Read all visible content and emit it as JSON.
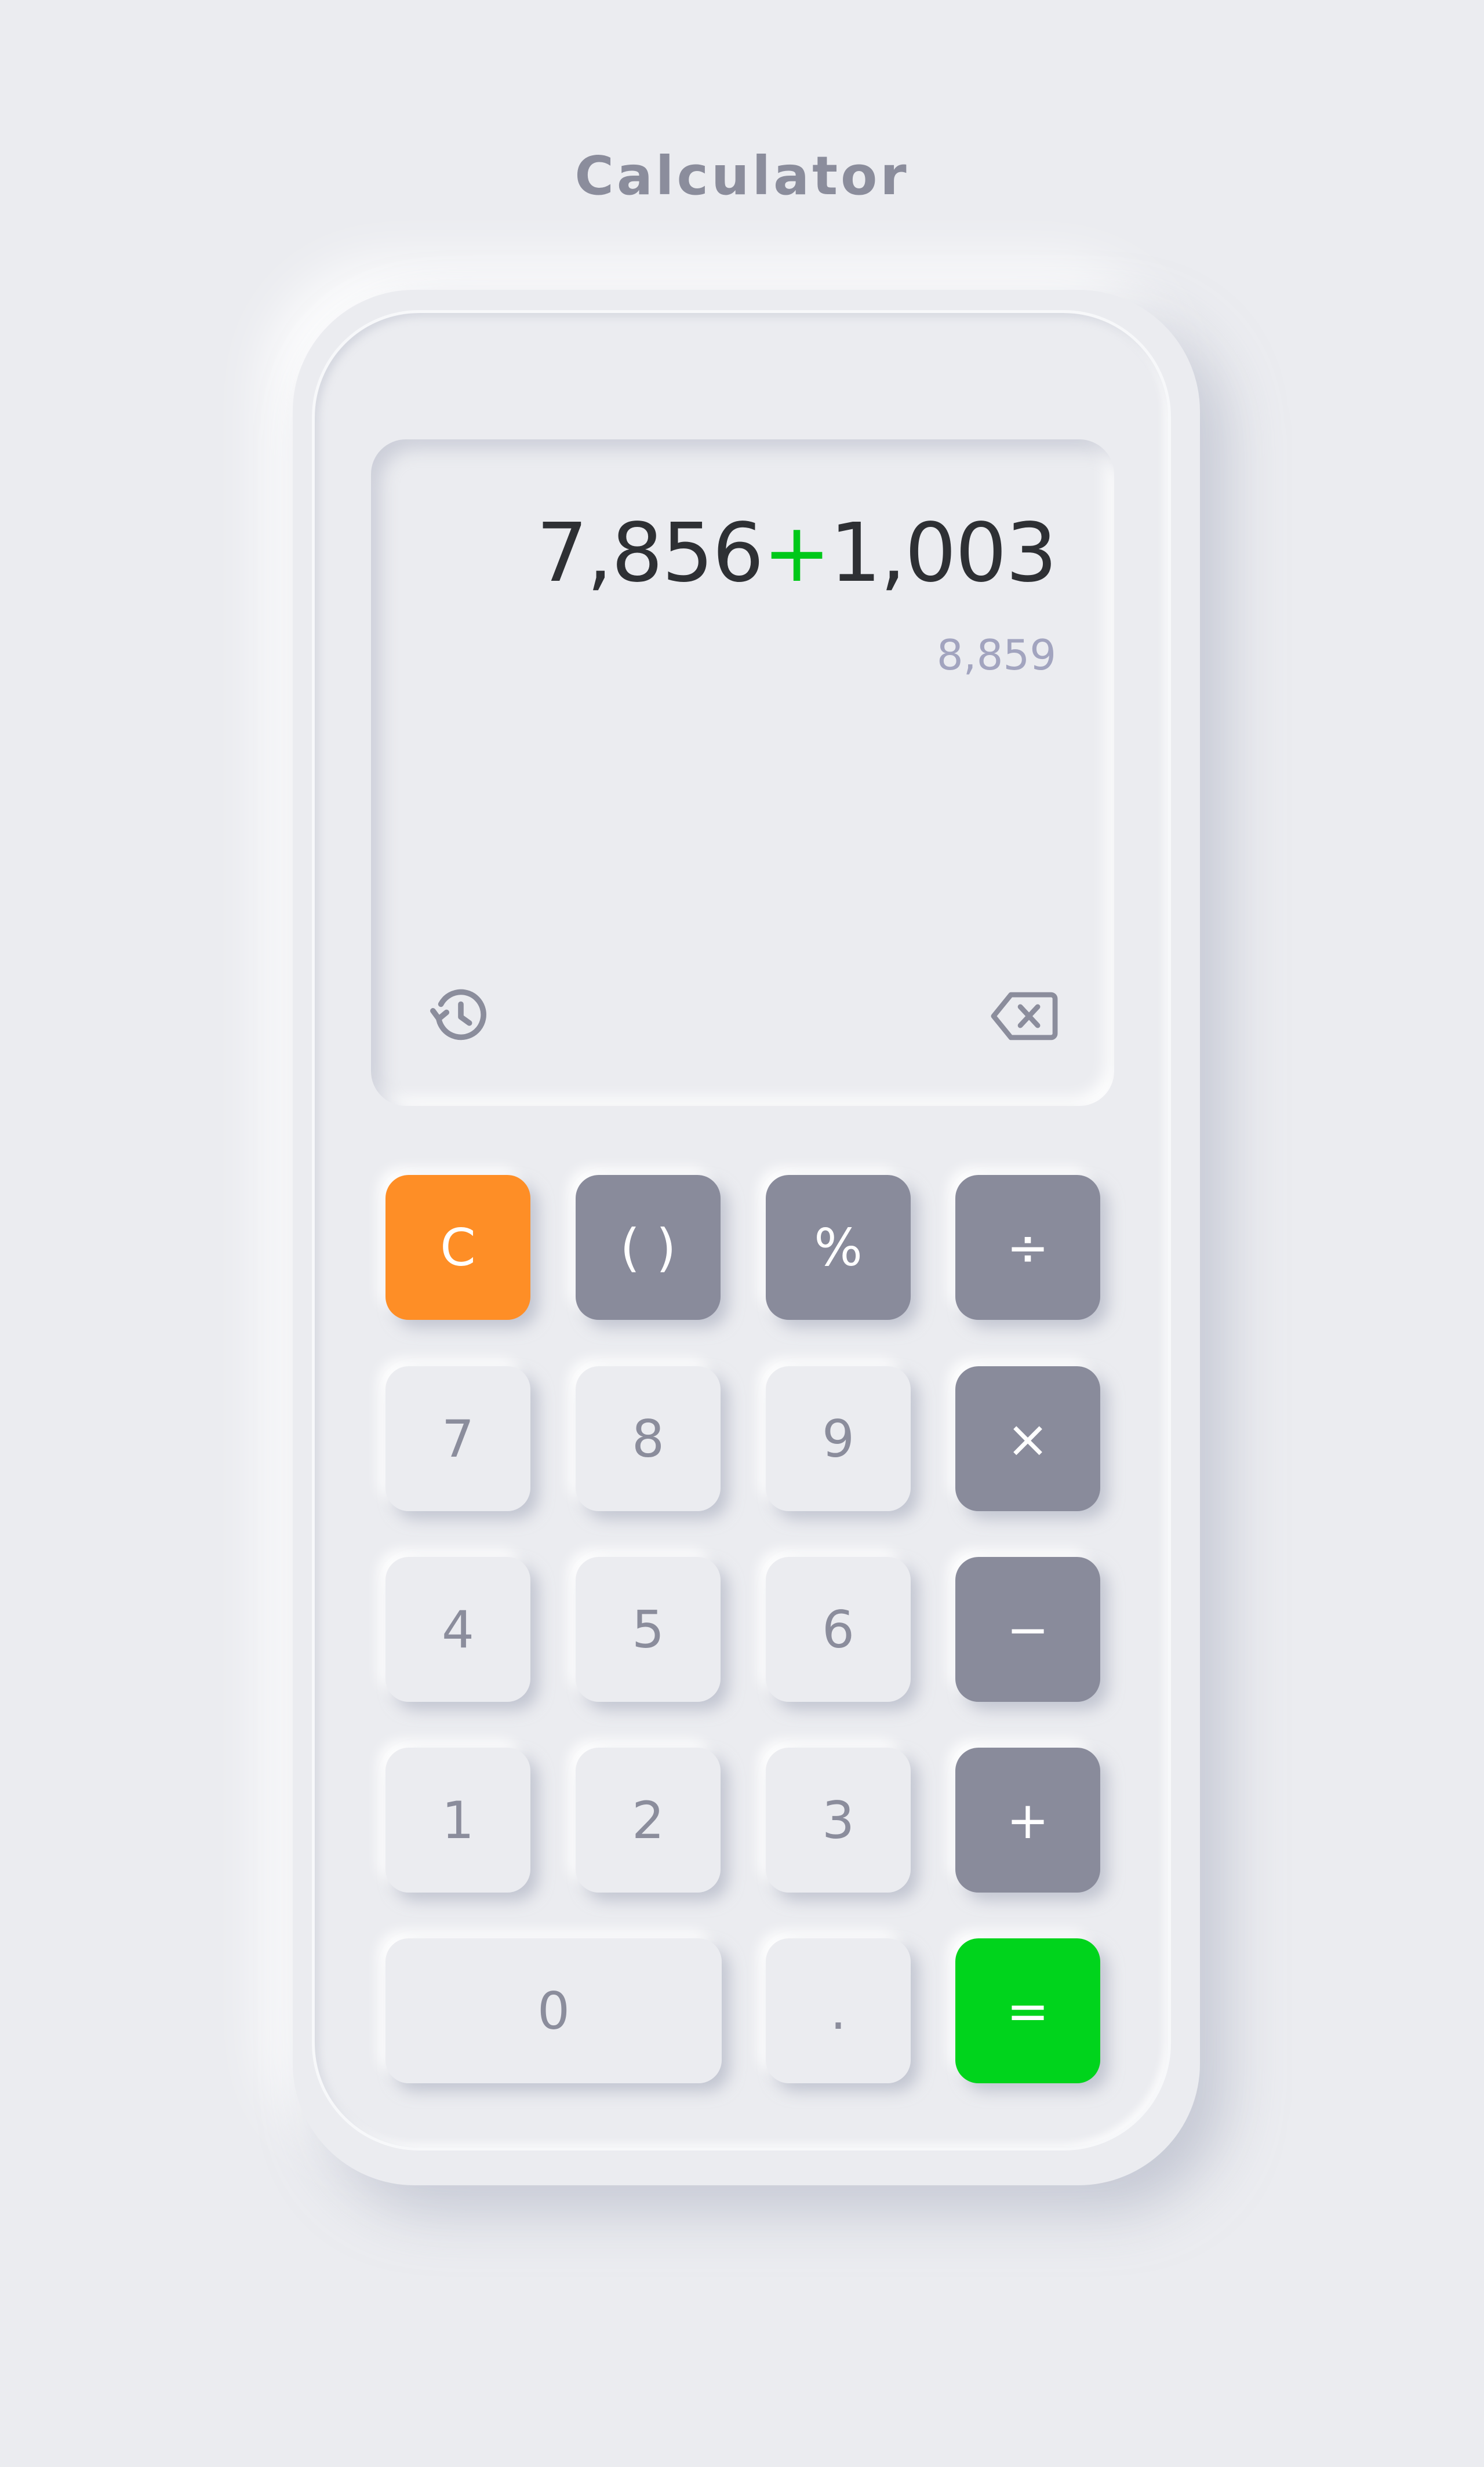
{
  "app": {
    "title": "Calculator"
  },
  "display": {
    "operand1": "7,856",
    "operator": "+",
    "operand2": "1,003",
    "result": "8,859",
    "history_icon": "history-icon",
    "backspace_icon": "backspace-icon"
  },
  "keypad": {
    "clear": "C",
    "parentheses": "( )",
    "percent": "%",
    "divide": "÷",
    "seven": "7",
    "eight": "8",
    "nine": "9",
    "multiply": "×",
    "four": "4",
    "five": "5",
    "six": "6",
    "minus": "−",
    "one": "1",
    "two": "2",
    "three": "3",
    "plus": "+",
    "zero": "0",
    "decimal": ".",
    "equals": "="
  },
  "colors": {
    "background": "#ebecf0",
    "clear_key": "#fe8e26",
    "operator_key": "#898b9b",
    "equals_key": "#00d41c",
    "operator_accent": "#00c819",
    "result_text": "#a2a4bf"
  }
}
